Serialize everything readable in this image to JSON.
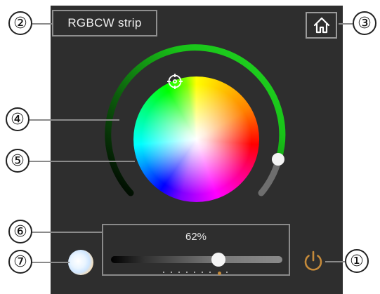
{
  "device": {
    "title": "RGBCW strip"
  },
  "brightness": {
    "label": "62%",
    "level_percent": 62
  },
  "callouts": {
    "power": "①",
    "title": "②",
    "home": "③",
    "ring": "④",
    "wheel": "⑤",
    "brightness": "⑥",
    "white": "⑦"
  },
  "colors": {
    "panel_bg": "#2e2e2e",
    "ring_green": "#18c318",
    "ring_grey": "#6e6e6e",
    "power_accent": "#c58a3a"
  },
  "icons": {
    "home": "home-icon",
    "power": "power-icon",
    "picker": "target-icon"
  }
}
